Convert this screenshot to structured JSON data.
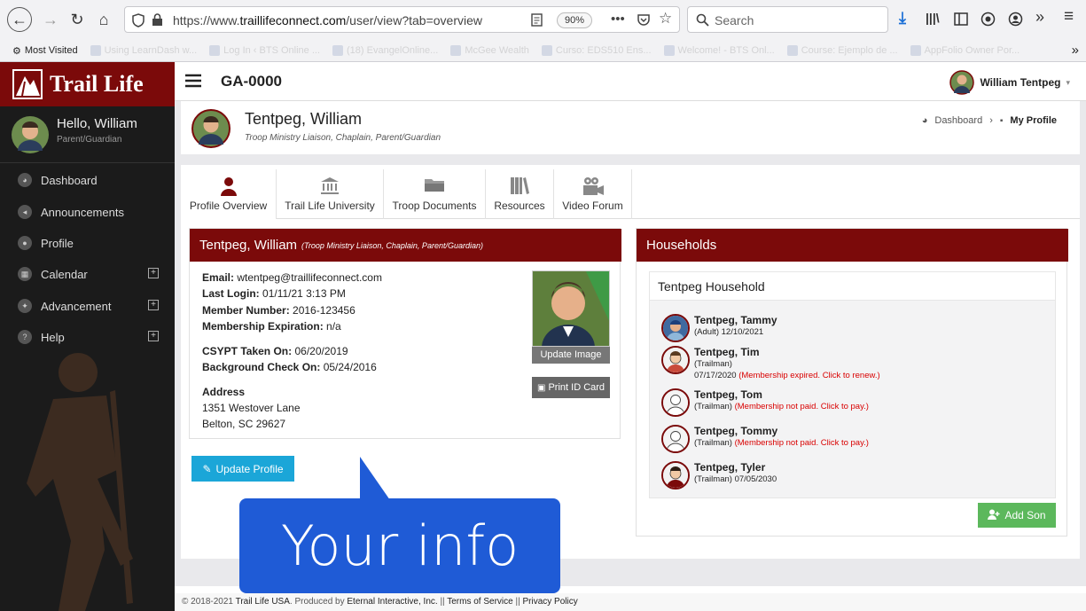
{
  "browser": {
    "url_prefix": "https://www.",
    "url_host": "traillifeconnect.com",
    "url_path": "/user/view?tab=overview",
    "zoom": "90%",
    "search_placeholder": "Search",
    "bookmarks": [
      {
        "label": "Most Visited"
      },
      {
        "label": "Using LearnDash w..."
      },
      {
        "label": "Log In ‹ BTS Online ..."
      },
      {
        "label": "(18) EvangelOnline..."
      },
      {
        "label": "McGee Wealth"
      },
      {
        "label": "Curso: EDS510 Ens..."
      },
      {
        "label": "Welcome! - BTS Onl..."
      },
      {
        "label": "Course: Ejemplo de ..."
      },
      {
        "label": "AppFolio Owner Por..."
      }
    ]
  },
  "sidebar": {
    "logo": "Trail Life",
    "hello_prefix": "Hello, ",
    "hello_name": "William",
    "role": "Parent/Guardian",
    "items": [
      {
        "label": "Dashboard",
        "icon": "dashboard-icon",
        "expandable": false
      },
      {
        "label": "Announcements",
        "icon": "megaphone-icon",
        "expandable": false
      },
      {
        "label": "Profile",
        "icon": "user-icon",
        "expandable": false
      },
      {
        "label": "Calendar",
        "icon": "calendar-icon",
        "expandable": true
      },
      {
        "label": "Advancement",
        "icon": "advancement-icon",
        "expandable": true
      },
      {
        "label": "Help",
        "icon": "help-icon",
        "expandable": true
      }
    ]
  },
  "header": {
    "org_code": "GA-0000",
    "user_name": "William Tentpeg"
  },
  "profile_head": {
    "name": "Tentpeg, William",
    "subtitle": "Troop Ministry Liaison, Chaplain, Parent/Guardian",
    "breadcrumb": [
      "Dashboard",
      "My Profile"
    ]
  },
  "tabs": [
    {
      "label": "Profile Overview",
      "icon": "user-icon"
    },
    {
      "label": "Trail Life University",
      "icon": "university-icon"
    },
    {
      "label": "Troop Documents",
      "icon": "folder-icon"
    },
    {
      "label": "Resources",
      "icon": "books-icon"
    },
    {
      "label": "Video Forum",
      "icon": "video-camera-icon"
    }
  ],
  "profile_card": {
    "name": "Tentpeg, William",
    "roles": "(Troop Ministry Liaison, Chaplain, Parent/Guardian)",
    "email_label": "Email:",
    "email": "wtentpeg@traillifeconnect.com",
    "last_login_label": "Last Login:",
    "last_login": "01/11/21 3:13 PM",
    "member_number_label": "Member Number:",
    "member_number": "2016-123456",
    "expiration_label": "Membership Expiration:",
    "expiration": "n/a",
    "csypt_label": "CSYPT Taken On:",
    "csypt": "06/20/2019",
    "background_label": "Background Check On:",
    "background": "05/24/2016",
    "address_label": "Address",
    "address_line1": "1351 Westover Lane",
    "address_line2": "Belton, SC 29627",
    "update_image": "Update Image",
    "print_id": "Print ID Card",
    "update_profile": "Update Profile"
  },
  "households": {
    "title": "Households",
    "household_name": "Tentpeg Household",
    "members": [
      {
        "name": "Tentpeg, Tammy",
        "role": "(Adult)",
        "detail": "12/10/2021",
        "alert": ""
      },
      {
        "name": "Tentpeg, Tim",
        "role": "(Trailman)",
        "detail": "07/17/2020",
        "alert": "(Membership expired. Click to renew.)"
      },
      {
        "name": "Tentpeg, Tom",
        "role": "(Trailman)",
        "detail": "",
        "alert": "(Membership not paid. Click to pay.)"
      },
      {
        "name": "Tentpeg, Tommy",
        "role": "(Trailman)",
        "detail": "",
        "alert": "(Membership not paid. Click to pay.)"
      },
      {
        "name": "Tentpeg, Tyler",
        "role": "(Trailman)",
        "detail": "07/05/2030",
        "alert": ""
      }
    ],
    "add_son": "Add Son"
  },
  "callout": {
    "text": "Your info"
  },
  "footer": {
    "copyright": "© 2018-2021 ",
    "org": "Trail Life USA",
    "produced": ". Produced by ",
    "producer": "Eternal Interactive, Inc.",
    "sep": " || ",
    "terms": "Terms of Service",
    "privacy": "Privacy Policy"
  },
  "colors": {
    "brand": "#7b0a0a",
    "accent": "#1ba6d8",
    "success": "#5cb85c",
    "alert": "#d90000",
    "callout": "#1f5bd6"
  }
}
